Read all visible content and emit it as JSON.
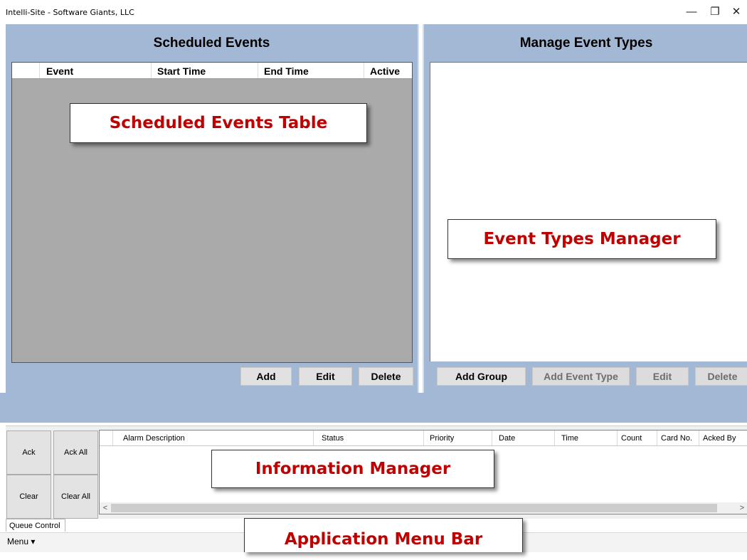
{
  "window": {
    "title": "Intelli-Site - Software Giants, LLC",
    "minimize_glyph": "—",
    "restore_glyph": "❐",
    "close_glyph": "✕"
  },
  "scheduled_events": {
    "title": "Scheduled Events",
    "columns": [
      "Event",
      "Start Time",
      "End Time",
      "Active"
    ],
    "buttons": {
      "add": "Add",
      "edit": "Edit",
      "delete": "Delete"
    }
  },
  "manage_event_types": {
    "title": "Manage Event Types",
    "buttons": {
      "add_group": "Add Group",
      "add_event_type": "Add Event Type",
      "edit": "Edit",
      "delete": "Delete"
    }
  },
  "information_manager": {
    "buttons": {
      "ack": "Ack",
      "ack_all": "Ack All",
      "clear": "Clear",
      "clear_all": "Clear All"
    },
    "columns": [
      "Alarm Description",
      "Status",
      "Priority",
      "Date",
      "Time",
      "Count",
      "Card No.",
      "Acked By"
    ],
    "scroll_left_glyph": "<",
    "scroll_right_glyph": ">"
  },
  "tabs": {
    "queue_control": "Queue Control"
  },
  "menubar": {
    "menu_label": "Menu ▾"
  },
  "callouts": {
    "scheduled_events_table": "Scheduled Events Table",
    "event_types_manager": "Event Types Manager",
    "information_manager": "Information Manager",
    "application_menu_bar": "Application Menu Bar"
  },
  "colors": {
    "panel_background": "#a3b8d4",
    "grid_background": "#aaaaaa",
    "callout_text": "#c00000"
  }
}
